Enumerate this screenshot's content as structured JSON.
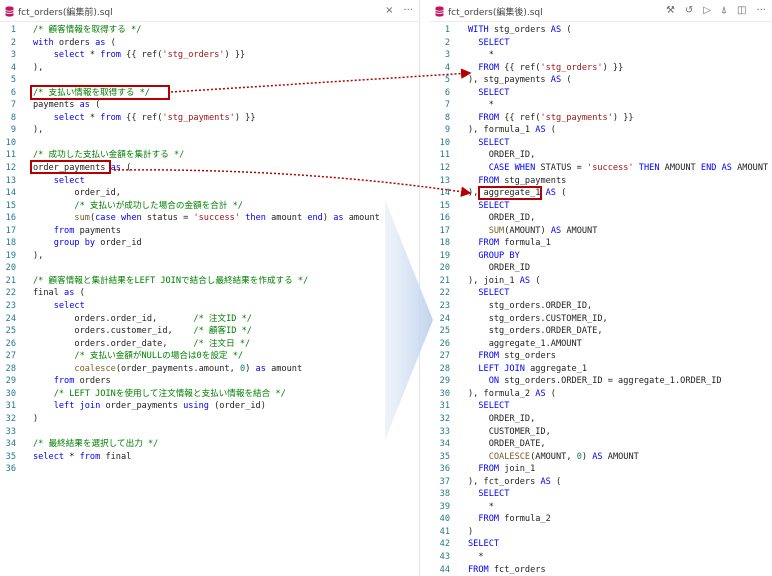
{
  "left_tab": {
    "title": "fct_orders(編集前).sql",
    "close": "×",
    "more": "···"
  },
  "right_tab": {
    "title": "fct_orders(編集後).sql",
    "fct_orders(編集後).sql_alt": "fct_orders(編集後).sql",
    "actions": [
      "⚒",
      "↺",
      "▷",
      "⍋",
      "◫",
      "···"
    ]
  },
  "colors": {
    "highlight_box": "#b40000",
    "keyword": "#0000ff",
    "string": "#a31515",
    "comment": "#008000",
    "line_number": "#237893",
    "function": "#795e26"
  },
  "left_lines": [
    [
      [
        "c",
        "/* 顧客情報を取得する */"
      ]
    ],
    [
      [
        "k",
        "with"
      ],
      [
        "",
        " orders "
      ],
      [
        "k",
        "as"
      ],
      [
        "",
        " ("
      ]
    ],
    [
      [
        "",
        "    "
      ],
      [
        "k",
        "select"
      ],
      [
        "",
        " * "
      ],
      [
        "k",
        "from"
      ],
      [
        "",
        " {{ ref("
      ],
      [
        "s",
        "'stg_orders'"
      ],
      [
        "",
        ") }}"
      ]
    ],
    [
      [
        "",
        "),"
      ]
    ],
    [],
    [
      [
        "c",
        "/* 支払い情報を取得する */"
      ]
    ],
    [
      [
        "",
        "payments "
      ],
      [
        "k",
        "as"
      ],
      [
        "",
        " ("
      ]
    ],
    [
      [
        "",
        "    "
      ],
      [
        "k",
        "select"
      ],
      [
        "",
        " * "
      ],
      [
        "k",
        "from"
      ],
      [
        "",
        " {{ ref("
      ],
      [
        "s",
        "'stg_payments'"
      ],
      [
        "",
        ") }}"
      ]
    ],
    [
      [
        "",
        "),"
      ]
    ],
    [],
    [
      [
        "c",
        "/* 成功した支払い金額を集計する */"
      ]
    ],
    [
      [
        "",
        "order_payments "
      ],
      [
        "k",
        "as"
      ],
      [
        "",
        " ("
      ]
    ],
    [
      [
        "",
        "    "
      ],
      [
        "k",
        "select"
      ]
    ],
    [
      [
        "",
        "        order_id,"
      ]
    ],
    [
      [
        "",
        "        "
      ],
      [
        "c",
        "/* 支払いが成功した場合の金額を合計 */"
      ]
    ],
    [
      [
        "",
        "        "
      ],
      [
        "f",
        "sum"
      ],
      [
        "",
        "("
      ],
      [
        "k",
        "case when"
      ],
      [
        "",
        " status = "
      ],
      [
        "s",
        "'success'"
      ],
      [
        "",
        " "
      ],
      [
        "k",
        "then"
      ],
      [
        "",
        " amount "
      ],
      [
        "k",
        "end"
      ],
      [
        "",
        ") "
      ],
      [
        "k",
        "as"
      ],
      [
        "",
        " amount"
      ]
    ],
    [
      [
        "",
        "    "
      ],
      [
        "k",
        "from"
      ],
      [
        "",
        " payments"
      ]
    ],
    [
      [
        "",
        "    "
      ],
      [
        "k",
        "group by"
      ],
      [
        "",
        " order_id"
      ]
    ],
    [
      [
        "",
        "),"
      ]
    ],
    [],
    [
      [
        "c",
        "/* 顧客情報と集計結果をLEFT JOINで結合し最終結果を作成する */"
      ]
    ],
    [
      [
        "",
        "final "
      ],
      [
        "k",
        "as"
      ],
      [
        "",
        " ("
      ]
    ],
    [
      [
        "",
        "    "
      ],
      [
        "k",
        "select"
      ]
    ],
    [
      [
        "",
        "        orders.order_id,       "
      ],
      [
        "c",
        "/* 注文ID */"
      ]
    ],
    [
      [
        "",
        "        orders.customer_id,    "
      ],
      [
        "c",
        "/* 顧客ID */"
      ]
    ],
    [
      [
        "",
        "        orders.order_date,     "
      ],
      [
        "c",
        "/* 注文日 */"
      ]
    ],
    [
      [
        "",
        "        "
      ],
      [
        "c",
        "/* 支払い金額がNULLの場合は0を設定 */"
      ]
    ],
    [
      [
        "",
        "        "
      ],
      [
        "f",
        "coalesce"
      ],
      [
        "",
        "(order_payments.amount, "
      ],
      [
        "n",
        "0"
      ],
      [
        "",
        ") "
      ],
      [
        "k",
        "as"
      ],
      [
        "",
        " amount"
      ]
    ],
    [
      [
        "",
        "    "
      ],
      [
        "k",
        "from"
      ],
      [
        "",
        " orders"
      ]
    ],
    [
      [
        "",
        "    "
      ],
      [
        "c",
        "/* LEFT JOINを使用して注文情報と支払い情報を結合 */"
      ]
    ],
    [
      [
        "",
        "    "
      ],
      [
        "k",
        "left join"
      ],
      [
        "",
        " order_payments "
      ],
      [
        "k",
        "using"
      ],
      [
        "",
        " (order_id)"
      ]
    ],
    [
      [
        "",
        ")"
      ]
    ],
    [],
    [
      [
        "c",
        "/* 最終結果を選択して出力 */"
      ]
    ],
    [
      [
        "k",
        "select"
      ],
      [
        "",
        " * "
      ],
      [
        "k",
        "from"
      ],
      [
        "",
        " final"
      ]
    ],
    []
  ],
  "right_lines": [
    [
      [
        "k",
        "WITH"
      ],
      [
        "",
        " stg_orders "
      ],
      [
        "k",
        "AS"
      ],
      [
        "",
        " ("
      ]
    ],
    [
      [
        "",
        "  "
      ],
      [
        "k",
        "SELECT"
      ]
    ],
    [
      [
        "",
        "    *"
      ]
    ],
    [
      [
        "",
        "  "
      ],
      [
        "k",
        "FROM"
      ],
      [
        "",
        " {{ ref("
      ],
      [
        "s",
        "'stg_orders'"
      ],
      [
        "",
        ") }}"
      ]
    ],
    [
      [
        "",
        "), stg_payments "
      ],
      [
        "k",
        "AS"
      ],
      [
        "",
        " ("
      ]
    ],
    [
      [
        "",
        "  "
      ],
      [
        "k",
        "SELECT"
      ]
    ],
    [
      [
        "",
        "    *"
      ]
    ],
    [
      [
        "",
        "  "
      ],
      [
        "k",
        "FROM"
      ],
      [
        "",
        " {{ ref("
      ],
      [
        "s",
        "'stg_payments'"
      ],
      [
        "",
        ") }}"
      ]
    ],
    [
      [
        "",
        "), formula_1 "
      ],
      [
        "k",
        "AS"
      ],
      [
        "",
        " ("
      ]
    ],
    [
      [
        "",
        "  "
      ],
      [
        "k",
        "SELECT"
      ]
    ],
    [
      [
        "",
        "    ORDER_ID,"
      ]
    ],
    [
      [
        "",
        "    "
      ],
      [
        "k",
        "CASE WHEN"
      ],
      [
        "",
        " STATUS = "
      ],
      [
        "s",
        "'success'"
      ],
      [
        "",
        " "
      ],
      [
        "k",
        "THEN"
      ],
      [
        "",
        " AMOUNT "
      ],
      [
        "k",
        "END AS"
      ],
      [
        "",
        " AMOUNT"
      ]
    ],
    [
      [
        "",
        "  "
      ],
      [
        "k",
        "FROM"
      ],
      [
        "",
        " stg_payments"
      ]
    ],
    [
      [
        "",
        "), aggregate_1 "
      ],
      [
        "k",
        "AS"
      ],
      [
        "",
        " ("
      ]
    ],
    [
      [
        "",
        "  "
      ],
      [
        "k",
        "SELECT"
      ]
    ],
    [
      [
        "",
        "    ORDER_ID,"
      ]
    ],
    [
      [
        "",
        "    "
      ],
      [
        "f",
        "SUM"
      ],
      [
        "",
        "(AMOUNT) "
      ],
      [
        "k",
        "AS"
      ],
      [
        "",
        " AMOUNT"
      ]
    ],
    [
      [
        "",
        "  "
      ],
      [
        "k",
        "FROM"
      ],
      [
        "",
        " formula_1"
      ]
    ],
    [
      [
        "",
        "  "
      ],
      [
        "k",
        "GROUP BY"
      ]
    ],
    [
      [
        "",
        "    ORDER_ID"
      ]
    ],
    [
      [
        "",
        "), join_1 "
      ],
      [
        "k",
        "AS"
      ],
      [
        "",
        " ("
      ]
    ],
    [
      [
        "",
        "  "
      ],
      [
        "k",
        "SELECT"
      ]
    ],
    [
      [
        "",
        "    stg_orders.ORDER_ID,"
      ]
    ],
    [
      [
        "",
        "    stg_orders.CUSTOMER_ID,"
      ]
    ],
    [
      [
        "",
        "    stg_orders.ORDER_DATE,"
      ]
    ],
    [
      [
        "",
        "    aggregate_1.AMOUNT"
      ]
    ],
    [
      [
        "",
        "  "
      ],
      [
        "k",
        "FROM"
      ],
      [
        "",
        " stg_orders"
      ]
    ],
    [
      [
        "",
        "  "
      ],
      [
        "k",
        "LEFT JOIN"
      ],
      [
        "",
        " aggregate_1"
      ]
    ],
    [
      [
        "",
        "    "
      ],
      [
        "k",
        "ON"
      ],
      [
        "",
        " stg_orders.ORDER_ID = aggregate_1.ORDER_ID"
      ]
    ],
    [
      [
        "",
        "), formula_2 "
      ],
      [
        "k",
        "AS"
      ],
      [
        "",
        " ("
      ]
    ],
    [
      [
        "",
        "  "
      ],
      [
        "k",
        "SELECT"
      ]
    ],
    [
      [
        "",
        "    ORDER_ID,"
      ]
    ],
    [
      [
        "",
        "    CUSTOMER_ID,"
      ]
    ],
    [
      [
        "",
        "    ORDER_DATE,"
      ]
    ],
    [
      [
        "",
        "    "
      ],
      [
        "f",
        "COALESCE"
      ],
      [
        "",
        "(AMOUNT, "
      ],
      [
        "n",
        "0"
      ],
      [
        "",
        ") "
      ],
      [
        "k",
        "AS"
      ],
      [
        "",
        " AMOUNT"
      ]
    ],
    [
      [
        "",
        "  "
      ],
      [
        "k",
        "FROM"
      ],
      [
        "",
        " join_1"
      ]
    ],
    [
      [
        "",
        "), fct_orders "
      ],
      [
        "k",
        "AS"
      ],
      [
        "",
        " ("
      ]
    ],
    [
      [
        "",
        "  "
      ],
      [
        "k",
        "SELECT"
      ]
    ],
    [
      [
        "",
        "    *"
      ]
    ],
    [
      [
        "",
        "  "
      ],
      [
        "k",
        "FROM"
      ],
      [
        "",
        " formula_2"
      ]
    ],
    [
      [
        "",
        ")"
      ]
    ],
    [
      [
        "k",
        "SELECT"
      ]
    ],
    [
      [
        "",
        "  *"
      ]
    ],
    [
      [
        "k",
        "FROM"
      ],
      [
        "",
        " fct_orders"
      ]
    ]
  ]
}
